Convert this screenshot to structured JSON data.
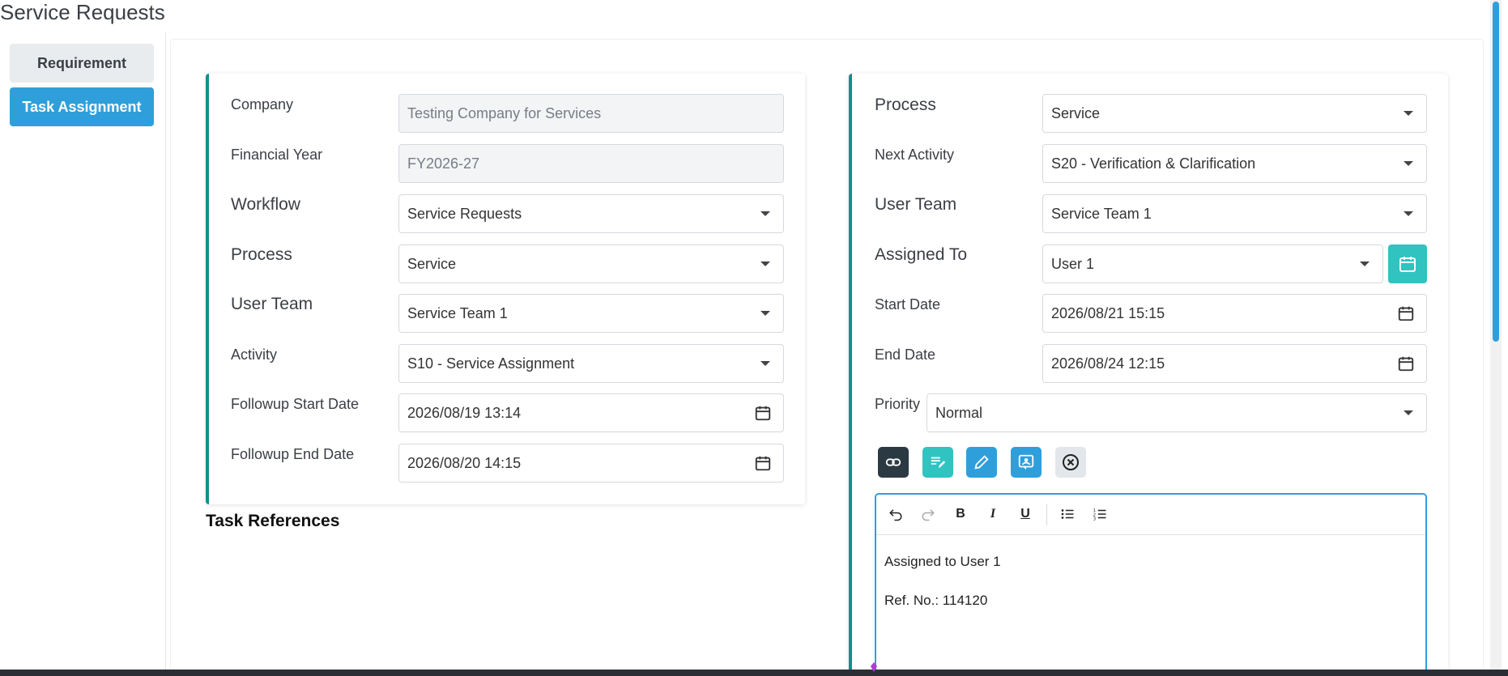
{
  "page": {
    "title": "Service Requests"
  },
  "sidenav": {
    "items": [
      {
        "label": "Requirement",
        "active": false
      },
      {
        "label": "Task Assignment",
        "active": true
      }
    ]
  },
  "left_panel": {
    "company": {
      "label": "Company",
      "value": "Testing Company for Services"
    },
    "financial_year": {
      "label": "Financial Year",
      "value": "FY2026-27"
    },
    "workflow": {
      "label": "Workflow",
      "value": "Service Requests"
    },
    "process": {
      "label": "Process",
      "value": "Service"
    },
    "user_team": {
      "label": "User Team",
      "value": "Service Team 1"
    },
    "activity": {
      "label": "Activity",
      "value": "S10 - Service Assignment"
    },
    "followup_start": {
      "label": "Followup Start Date",
      "value": "2026/08/19 13:14"
    },
    "followup_end": {
      "label": "Followup End Date",
      "value": "2026/08/20 14:15"
    }
  },
  "task_references": {
    "title": "Task References"
  },
  "right_panel": {
    "process": {
      "label": "Process",
      "value": "Service"
    },
    "next_activity": {
      "label": "Next Activity",
      "value": "S20 - Verification & Clarification"
    },
    "user_team": {
      "label": "User Team",
      "value": "Service Team 1"
    },
    "assigned_to": {
      "label": "Assigned To",
      "value": "User 1"
    },
    "start_date": {
      "label": "Start Date",
      "value": "2026/08/21 15:15"
    },
    "end_date": {
      "label": "End Date",
      "value": "2026/08/24 12:15"
    },
    "priority": {
      "label": "Priority",
      "value": "Normal"
    },
    "actions": [
      "link-icon",
      "note-edit-icon",
      "pencil-icon",
      "contact-card-icon",
      "close-circle-icon"
    ]
  },
  "editor": {
    "toolbar": [
      "undo-icon",
      "redo-icon",
      "bold-icon",
      "italic-icon",
      "underline-icon",
      "bullet-list-icon",
      "numbered-list-icon"
    ],
    "lines": [
      "Assigned to User 1",
      "Ref. No.: 114120"
    ]
  },
  "colors": {
    "accent": "#2f9fdb",
    "panel_border": "#138f8c",
    "teal_button": "#31c3c0",
    "dark_button": "#2b3a42"
  }
}
